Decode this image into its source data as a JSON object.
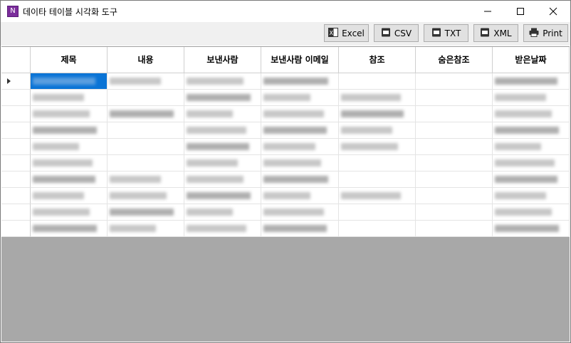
{
  "window": {
    "title": "데이타 테이블 시각화 도구",
    "app_icon_letter": "N"
  },
  "toolbar": {
    "excel_label": "Excel",
    "csv_label": "CSV",
    "txt_label": "TXT",
    "xml_label": "XML",
    "print_label": "Print"
  },
  "table": {
    "headers": [
      "제목",
      "내용",
      "보낸사람",
      "보낸사람 이메일",
      "참조",
      "숨은참조",
      "받은날짜"
    ],
    "row_count": 10,
    "selected_row": 0,
    "selected_col": 0,
    "rows": [
      [
        true,
        true,
        true,
        true,
        false,
        false,
        true
      ],
      [
        true,
        false,
        true,
        true,
        true,
        false,
        true
      ],
      [
        true,
        true,
        true,
        true,
        true,
        false,
        true
      ],
      [
        true,
        false,
        true,
        true,
        true,
        false,
        true
      ],
      [
        true,
        false,
        true,
        true,
        true,
        false,
        true
      ],
      [
        true,
        false,
        true,
        true,
        false,
        false,
        true
      ],
      [
        true,
        true,
        true,
        true,
        false,
        false,
        true
      ],
      [
        true,
        true,
        true,
        true,
        true,
        false,
        true
      ],
      [
        true,
        true,
        true,
        true,
        false,
        false,
        true
      ],
      [
        true,
        true,
        true,
        true,
        false,
        false,
        true
      ]
    ]
  },
  "colors": {
    "selection": "#0a74d6",
    "empty_area": "#a8a8a8"
  }
}
